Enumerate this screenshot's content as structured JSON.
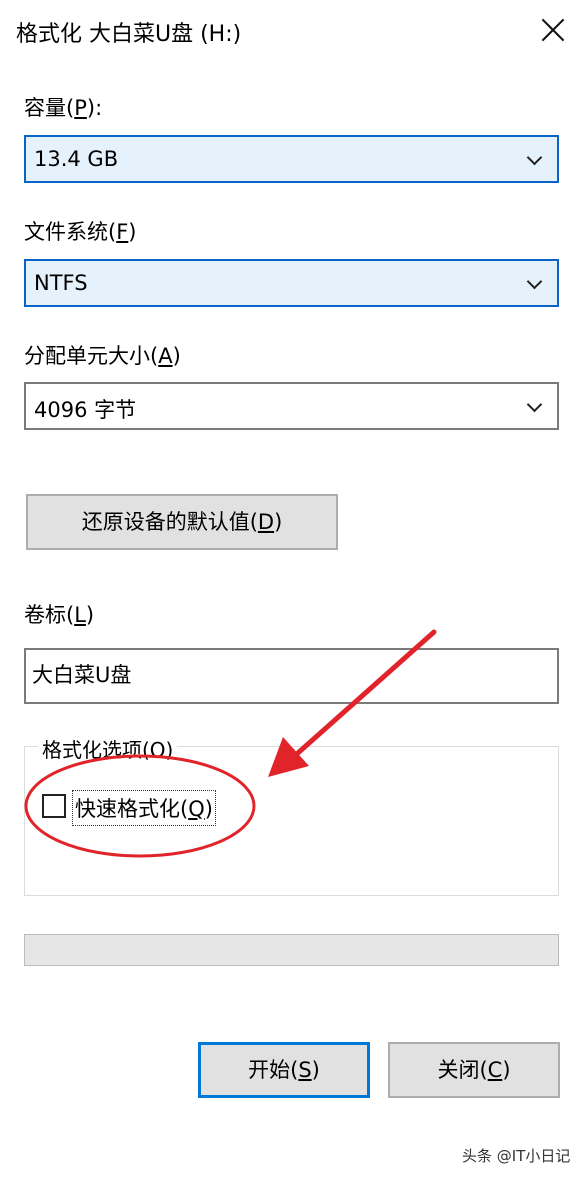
{
  "window": {
    "title": "格式化 大白菜U盘 (H:)"
  },
  "capacity": {
    "label_main": "容量(",
    "label_key": "P",
    "label_end": "):",
    "value": "13.4 GB"
  },
  "filesystem": {
    "label_main": "文件系统(",
    "label_key": "F",
    "label_end": ")",
    "value": "NTFS"
  },
  "allocation": {
    "label_main": "分配单元大小(",
    "label_key": "A",
    "label_end": ")",
    "value": "4096 字节"
  },
  "restore_button": {
    "label_main": "还原设备的默认值(",
    "label_key": "D",
    "label_end": ")"
  },
  "volume_label": {
    "label_main": "卷标(",
    "label_key": "L",
    "label_end": ")",
    "value": "大白菜U盘"
  },
  "format_options": {
    "legend": "格式化选项(O)",
    "quick_format": {
      "label_main": "快速格式化(",
      "label_key": "Q",
      "label_end": ")",
      "checked": false
    }
  },
  "progress": {
    "value": 0
  },
  "buttons": {
    "start": {
      "label_main": "开始(",
      "label_key": "S",
      "label_end": ")"
    },
    "close": {
      "label_main": "关闭(",
      "label_key": "C",
      "label_end": ")"
    }
  },
  "annotation": {
    "color": "#e0242a"
  },
  "watermark": "头条 @IT小日记"
}
